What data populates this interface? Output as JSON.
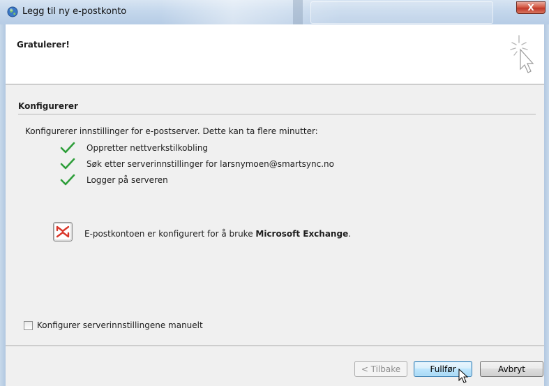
{
  "window": {
    "title": "Legg til ny e-postkonto",
    "close_label": "X",
    "app_icon": "globe-icon"
  },
  "header": {
    "title": "Gratulerer!",
    "icon": "wizard-sparkle-cursor-icon"
  },
  "section": {
    "title": "Konfigurerer",
    "intro": "Konfigurerer innstillinger for e-postserver. Dette kan ta flere minutter:",
    "steps": [
      {
        "label": "Oppretter nettverkstilkobling",
        "status": "done"
      },
      {
        "label": "Søk etter serverinnstillinger for larsnymoen@smartsync.no",
        "status": "done"
      },
      {
        "label": "Logger på serveren",
        "status": "done"
      }
    ],
    "result_prefix": "E-postkontoen er konfigurert for å bruke ",
    "result_product": "Microsoft Exchange",
    "result_suffix": "."
  },
  "options": {
    "manual_config_label": "Konfigurer serverinnstillingene manuelt",
    "manual_config_checked": false
  },
  "buttons": {
    "back_label": "< Tilbake",
    "finish_label": "Fullfør",
    "cancel_label": "Avbryt"
  },
  "colors": {
    "check": "#2e9e3a",
    "exchange": "#d9372a",
    "default_button": "#3c7fb1"
  }
}
